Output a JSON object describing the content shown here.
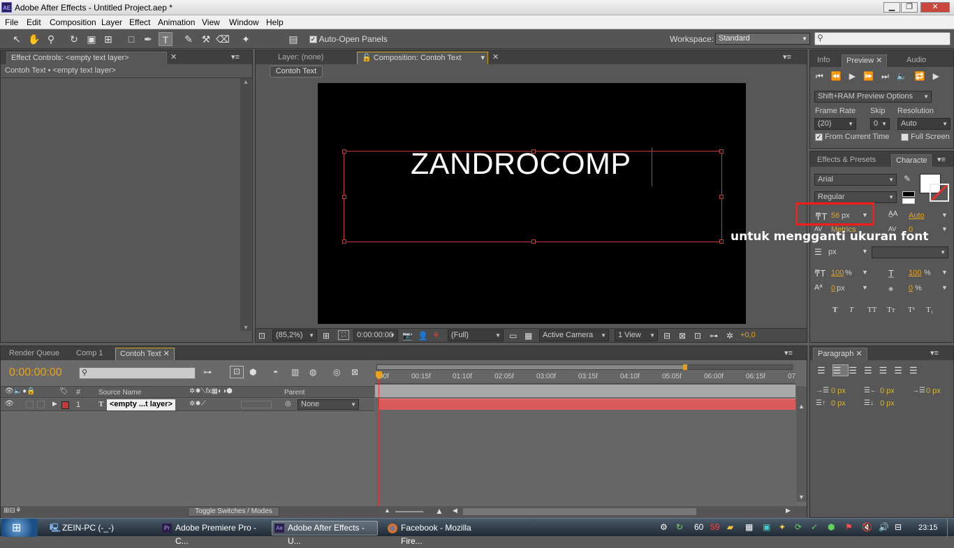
{
  "app": {
    "icon": "AE",
    "title": "Adobe After Effects - Untitled Project.aep *"
  },
  "window_controls": {
    "minimize": "▁",
    "restore": "❐",
    "close": "✕"
  },
  "menu": [
    "File",
    "Edit",
    "Composition",
    "Layer",
    "Effect",
    "Animation",
    "View",
    "Window",
    "Help"
  ],
  "toolbar": {
    "auto_open_panels": "Auto-Open Panels",
    "workspace_label": "Workspace:",
    "workspace_value": "Standard",
    "search_placeholder": ""
  },
  "effect_controls": {
    "tab": "Effect Controls: <empty text layer>",
    "subtitle": "Contoh Text • <empty text layer>"
  },
  "viewer": {
    "tab_layer": "Layer: (none)",
    "tab_comp": "Composition: Contoh Text",
    "comp_button": "Contoh Text",
    "canvas_text": "ZANDROCOMP",
    "zoom": "(85,2%)",
    "timecode": "0:00:00:00",
    "quality": "(Full)",
    "camera": "Active Camera",
    "views": "1 View",
    "exposure": "+0,0"
  },
  "preview": {
    "tabs": [
      "Info",
      "Preview",
      "Audio"
    ],
    "ram_options": "Shift+RAM Preview Options",
    "frame_rate_label": "Frame Rate",
    "frame_rate": "(20)",
    "skip_label": "Skip",
    "skip": "0",
    "resolution_label": "Resolution",
    "resolution": "Auto",
    "from_current": "From Current Time",
    "full_screen": "Full Screen"
  },
  "character": {
    "tabs": [
      "Effects & Presets",
      "Characte"
    ],
    "font": "Arial",
    "style": "Regular",
    "size": "56",
    "size_unit": "px",
    "leading": "Auto",
    "kerning": "Metrics",
    "tracking": "0",
    "stroke_unit": "px",
    "vscale": "100",
    "hscale": "100",
    "pct": "%",
    "baseline": "0",
    "baseline_unit": "px",
    "tsume": "0",
    "tsume_unit": "%",
    "style_buttons": [
      "T",
      "T",
      "TT",
      "Tт",
      "T¹",
      "T₁"
    ]
  },
  "annotation": {
    "text": "untuk mengganti ukuran font",
    "color": "#ff2020"
  },
  "timeline": {
    "tabs": [
      "Render Queue",
      "Comp 1",
      "Contoh Text"
    ],
    "timecode": "0:00:00:00",
    "col_source": "Source Name",
    "col_parent": "Parent",
    "col_num": "#",
    "layer_num": "1",
    "layer_type": "T",
    "layer_name": "<empty ...t layer>",
    "layer_parent": "None",
    "ruler": [
      "00f",
      "00:15f",
      "01:10f",
      "02:05f",
      "03:00f",
      "03:15f",
      "04:10f",
      "05:05f",
      "06:00f",
      "06:15f",
      "07"
    ],
    "toggle": "Toggle Switches / Modes"
  },
  "paragraph": {
    "tab": "Paragraph",
    "val1": "0 px",
    "val2": "0 px",
    "val3": "0 px",
    "val4": "0 px",
    "val5": "0 px"
  },
  "taskbar": {
    "items": [
      "ZEIN-PC (-_-)",
      "Adobe Premiere Pro - C...",
      "Adobe After Effects - U...",
      "Facebook - Mozilla Fire..."
    ],
    "tray_60": "60",
    "tray_59": "59",
    "clock": "23:15"
  }
}
